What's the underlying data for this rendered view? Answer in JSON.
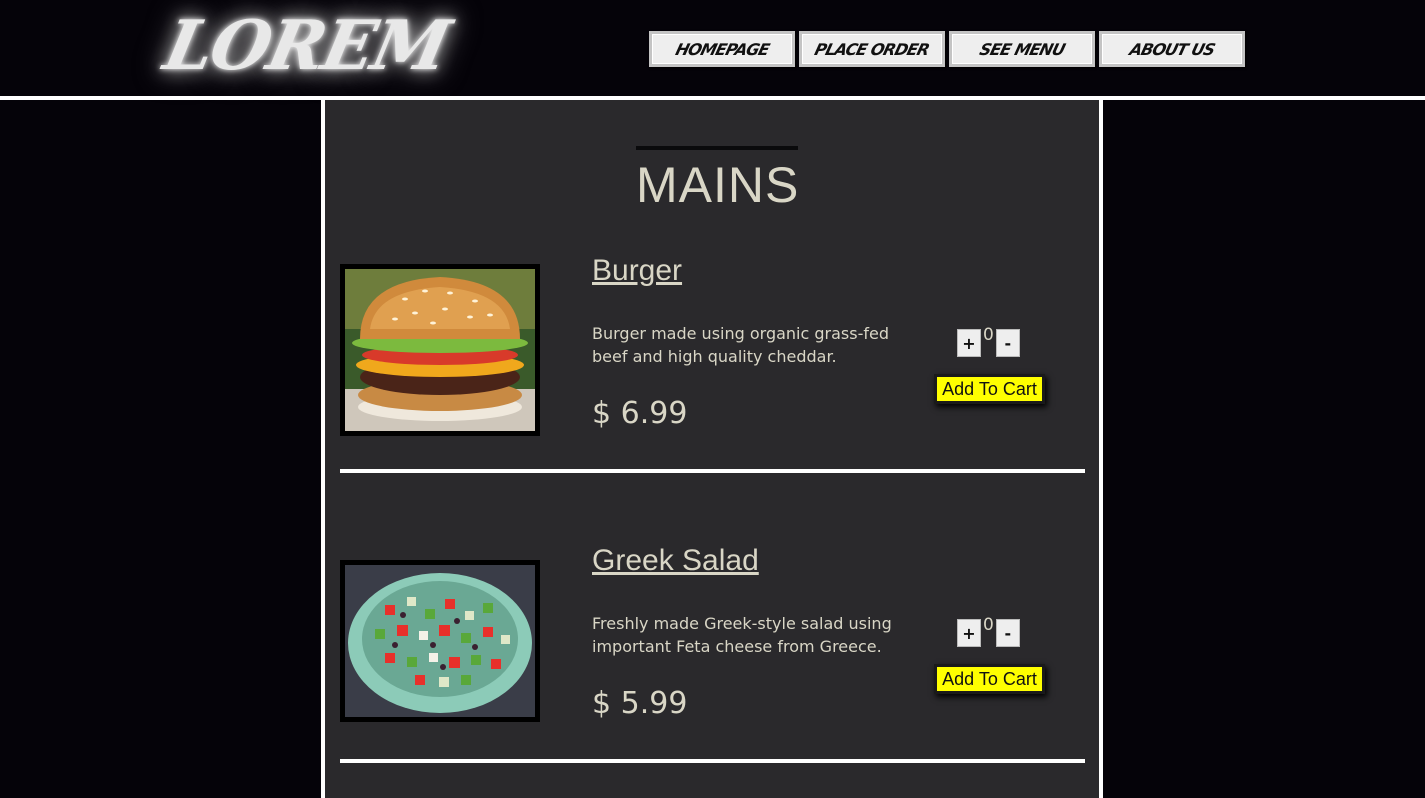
{
  "header": {
    "logo": "LOREM",
    "nav": [
      "HOMEPAGE",
      "PLACE ORDER",
      "SEE MENU",
      "ABOUT US"
    ]
  },
  "section": {
    "title": "MAINS"
  },
  "items": [
    {
      "name": "Burger",
      "description": "Burger made using organic grass-fed beef and high quality cheddar.",
      "price": "$ 6.99",
      "quantity": "0",
      "plus": "+",
      "minus": "-",
      "add_to_cart": "Add To Cart",
      "image": "burger-photo"
    },
    {
      "name": "Greek Salad",
      "description": "Freshly made Greek-style salad using important Feta cheese from Greece.",
      "price": "$ 5.99",
      "quantity": "0",
      "plus": "+",
      "minus": "-",
      "add_to_cart": "Add To Cart",
      "image": "greek-salad-photo"
    }
  ],
  "colors": {
    "background": "#050309",
    "panel": "#2a292c",
    "text": "#d9d6c6",
    "add_button": "#ffff00",
    "rule": "#ffffff"
  }
}
